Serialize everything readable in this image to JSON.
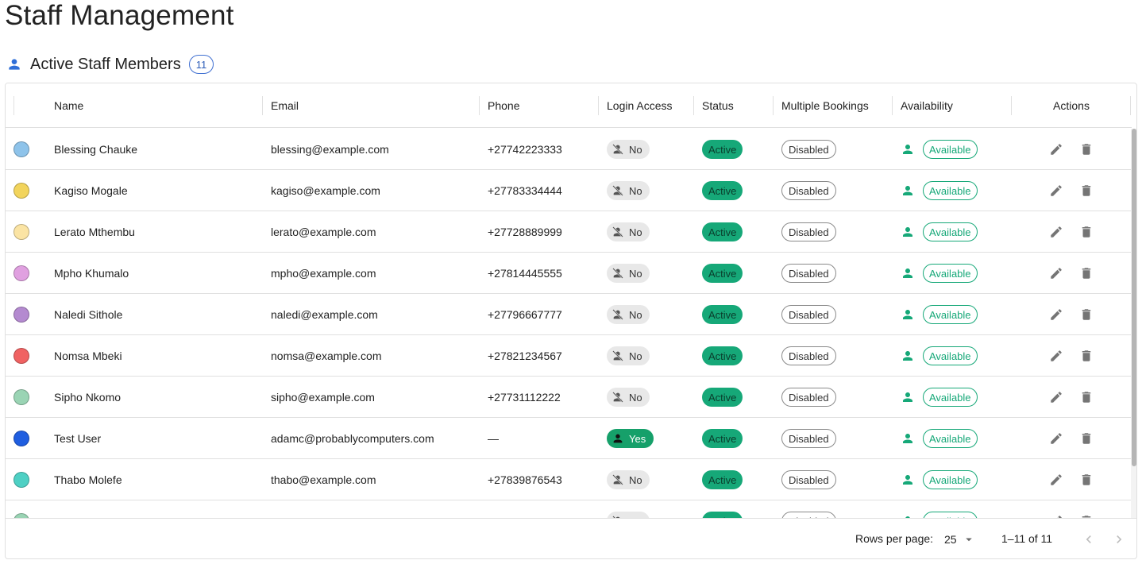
{
  "page": {
    "title": "Staff Management"
  },
  "section": {
    "title": "Active Staff Members",
    "count": "11",
    "icon": "person-icon",
    "accent": "#2f5fb9"
  },
  "table": {
    "columns": [
      {
        "key": "color",
        "label": ""
      },
      {
        "key": "name",
        "label": "Name"
      },
      {
        "key": "email",
        "label": "Email"
      },
      {
        "key": "phone",
        "label": "Phone"
      },
      {
        "key": "login",
        "label": "Login Access"
      },
      {
        "key": "status",
        "label": "Status"
      },
      {
        "key": "multi",
        "label": "Multiple Bookings"
      },
      {
        "key": "availability",
        "label": "Availability"
      },
      {
        "key": "actions",
        "label": "Actions"
      }
    ],
    "rows": [
      {
        "color": "#8ec3ea",
        "name": "Blessing Chauke",
        "email": "blessing@example.com",
        "phone": "+27742223333",
        "login": "No",
        "status": "Active",
        "multi": "Disabled",
        "availability": "Available"
      },
      {
        "color": "#f2d45c",
        "name": "Kagiso Mogale",
        "email": "kagiso@example.com",
        "phone": "+27783334444",
        "login": "No",
        "status": "Active",
        "multi": "Disabled",
        "availability": "Available"
      },
      {
        "color": "#fbe4a4",
        "name": "Lerato Mthembu",
        "email": "lerato@example.com",
        "phone": "+27728889999",
        "login": "No",
        "status": "Active",
        "multi": "Disabled",
        "availability": "Available"
      },
      {
        "color": "#e0a0e0",
        "name": "Mpho Khumalo",
        "email": "mpho@example.com",
        "phone": "+27814445555",
        "login": "No",
        "status": "Active",
        "multi": "Disabled",
        "availability": "Available"
      },
      {
        "color": "#b48ad0",
        "name": "Naledi Sithole",
        "email": "naledi@example.com",
        "phone": "+27796667777",
        "login": "No",
        "status": "Active",
        "multi": "Disabled",
        "availability": "Available"
      },
      {
        "color": "#f06262",
        "name": "Nomsa Mbeki",
        "email": "nomsa@example.com",
        "phone": "+27821234567",
        "login": "No",
        "status": "Active",
        "multi": "Disabled",
        "availability": "Available"
      },
      {
        "color": "#9ad4b4",
        "name": "Sipho Nkomo",
        "email": "sipho@example.com",
        "phone": "+27731112222",
        "login": "No",
        "status": "Active",
        "multi": "Disabled",
        "availability": "Available"
      },
      {
        "color": "#1f5ee0",
        "name": "Test User",
        "email": "adamc@probablycomputers.com",
        "phone": "—",
        "login": "Yes",
        "status": "Active",
        "multi": "Disabled",
        "availability": "Available"
      },
      {
        "color": "#4ed0c4",
        "name": "Thabo Molefe",
        "email": "thabo@example.com",
        "phone": "+27839876543",
        "login": "No",
        "status": "Active",
        "multi": "Disabled",
        "availability": "Available"
      },
      {
        "color": "#9ad4b4",
        "name": "",
        "email": "",
        "phone": "",
        "login": "No",
        "status": "Active",
        "multi": "Disabled",
        "availability": "Available"
      }
    ],
    "icons": {
      "no_login": "person-off-icon",
      "yes_login": "person-icon",
      "available": "person-icon",
      "edit": "pencil-icon",
      "delete": "trash-icon"
    }
  },
  "pagination": {
    "rows_label": "Rows per page:",
    "rows_value": "25",
    "range": "1–11 of 11"
  },
  "colors": {
    "active_green": "#16a878",
    "border": "#e0e0e0",
    "icon_grey": "#757575"
  }
}
